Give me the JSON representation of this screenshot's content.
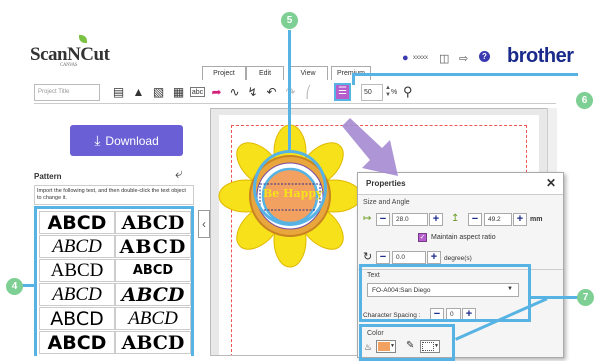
{
  "header": {
    "logo_text": "ScanNCut",
    "logo_sub": "CANVAS",
    "user_name": "xxxxx",
    "brand": "brother"
  },
  "tabs": [
    "Project",
    "Edit",
    "View",
    "Premium"
  ],
  "toolbar": {
    "project_title_placeholder": "Project Title",
    "zoom_value": "50",
    "zoom_unit": "%"
  },
  "sidebar": {
    "download_label": "Download",
    "pattern_title": "Pattern",
    "pattern_desc": "Import the following text, and then double-click the text object to change it.",
    "patterns": [
      "ABCD",
      "ABCD",
      "ABCD",
      "ABCD",
      "ABCD",
      "ABCD",
      "ABCD",
      "ABCD",
      "ABCD",
      "ABCD",
      "ABCD",
      "ABCD"
    ]
  },
  "canvas": {
    "sticker_text": "Be Happy"
  },
  "properties": {
    "title": "Properties",
    "size_angle_label": "Size and Angle",
    "width_value": "28.0",
    "height_value": "49.2",
    "unit": "mm",
    "maintain_aspect": "Maintain aspect ratio",
    "angle_value": "0.0",
    "angle_unit": "degree(s)",
    "text_label": "Text",
    "font_value": "FO-A004:San Diego",
    "char_spacing_label": "Character Spacing :",
    "char_spacing_value": "0",
    "color_label": "Color"
  },
  "callouts": [
    "5",
    "6",
    "4",
    "7"
  ],
  "colors": {
    "accent_blue": "#57b3e3",
    "badge_green": "#7dcf93",
    "download_purple": "#6a5fd4",
    "brand_navy": "#1a2a8a",
    "flower_yellow": "#f7e11a",
    "fill_orange": "#f2a160"
  }
}
